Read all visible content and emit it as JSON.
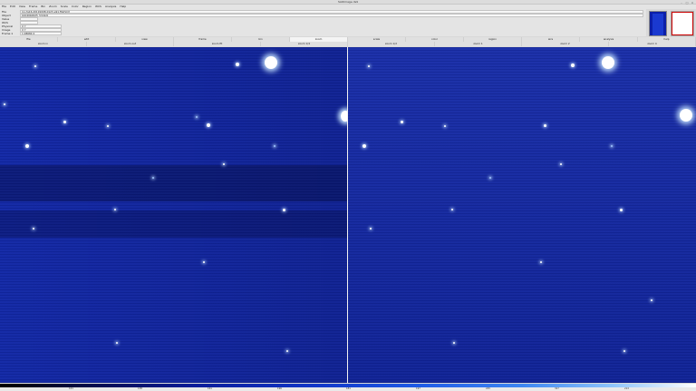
{
  "window": {
    "title": "SAOImage ds9",
    "min": "–",
    "max": "□",
    "close": "×"
  },
  "menu": [
    "File",
    "Edit",
    "View",
    "Frame",
    "Bin",
    "Zoom",
    "Scale",
    "Color",
    "Region",
    "WCS",
    "Analysis",
    "Help"
  ],
  "info": [
    {
      "label": "File",
      "value": "lco-fa16-20191008-0123-e91.fits[SCI]"
    },
    {
      "label": "Object",
      "value": "b1040b0025_53d1/6"
    },
    {
      "label": "Value",
      "value": ""
    },
    {
      "label": "WCS",
      "value": ""
    },
    {
      "label": "Physical",
      "value": "X   Y"
    },
    {
      "label": "Image",
      "value": "X   Y"
    },
    {
      "label": "Frame 1",
      "value": "1.08684   0"
    }
  ],
  "buttons_row1": [
    "file",
    "edit",
    "view",
    "frame",
    "bin",
    "zoom",
    "scale",
    "color",
    "region",
    "wcs",
    "analysis",
    "help"
  ],
  "buttons_row1_selected": 5,
  "buttons_row2": [
    "zoom in",
    "zoom out",
    "zoom fit",
    "zoom 1/4",
    "zoom 1/2",
    "zoom 1",
    "zoom 2",
    "zoom 4"
  ],
  "colorbar": {
    "ticks": [
      "101",
      "138",
      "161",
      "196",
      "181",
      "197",
      "225",
      "327",
      "213"
    ]
  },
  "colors": {
    "image_bg": "#1228a6",
    "accent": "#cc0000"
  }
}
